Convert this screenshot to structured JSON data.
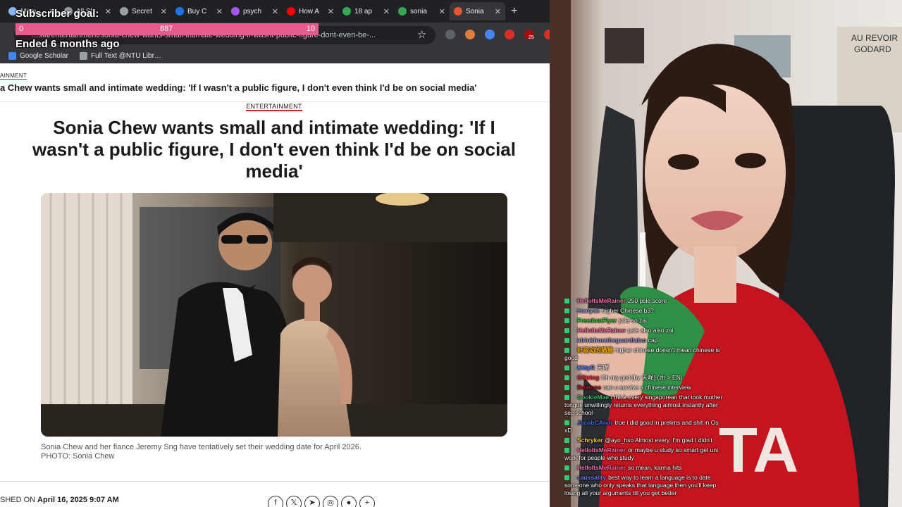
{
  "browser": {
    "tabs": [
      {
        "label": "Mem",
        "color": "#8ab4f8",
        "active": false
      },
      {
        "label": "All Sl",
        "color": "#9aa0a6",
        "active": false
      },
      {
        "label": "Secret",
        "color": "#9aa0a6",
        "active": false
      },
      {
        "label": "Buy C",
        "color": "#1a73e8",
        "active": false
      },
      {
        "label": "psych",
        "color": "#a855f7",
        "active": false
      },
      {
        "label": "How A",
        "color": "#ff0000",
        "active": false
      },
      {
        "label": "18 ap",
        "color": "#34a853",
        "active": false
      },
      {
        "label": "sonia",
        "color": "#34a853",
        "active": false
      },
      {
        "label": "Sonia",
        "color": "#e8542b",
        "active": true
      }
    ],
    "new_tab": "+",
    "url": "…sia/entertainment/sonia-chew-wants-small-intimate-wedding-if-wasnt-public-figure-dont-even-be-...",
    "bookmarks": [
      {
        "label": "Google Scholar",
        "color": "#4285f4"
      },
      {
        "label": "Full Text @NTU Libr…",
        "color": "#9aa0a6"
      }
    ],
    "extension_badge": "25"
  },
  "goal": {
    "title": "Subscriber goal:",
    "min": "0",
    "current": "887",
    "max": "10",
    "ended": "Ended 6 months ago",
    "bar_color": "#e65a8c",
    "progress": 1.0
  },
  "article": {
    "crumb": "AINMENT",
    "sticky_title": "a Chew wants small and intimate wedding: 'If I wasn't a public figure, I don't even think I'd be on social media'",
    "section": "ENTERTAINMENT",
    "headline": "Sonia Chew wants small and intimate wedding: 'If I wasn't a public figure, I don't even think I'd be on social media'",
    "caption": "Sonia Chew and her fiance Jeremy Sng have tentatively set their wedding date for April 2026.",
    "credit": "PHOTO: Sonia Chew",
    "published_label": "SHED ON",
    "published_date": "April 16, 2025 9:07 AM",
    "share": [
      "f",
      "𝕏",
      "➤",
      "◎",
      "●",
      "+"
    ]
  },
  "chat": [
    {
      "user": "HelloItsMeRainer",
      "color": "#ff6fb0",
      "text": "250 psle score"
    },
    {
      "user": "tsanyao",
      "color": "#9a9ad8",
      "text": "higher Chinese b3?"
    },
    {
      "user": "FreedomFlyer",
      "color": "#3fd13f",
      "text": "jolie so zai"
    },
    {
      "user": "HelloItsMeRainer",
      "color": "#ff6fb0",
      "text": "psle also also zai"
    },
    {
      "user": "idrinkfromtheguardialso",
      "color": "#9a9ad8",
      "text": "cap"
    },
    {
      "user": "好寂动的猫猫",
      "color": "#ffb300",
      "text": "higher chinese doesn't mean chinese is good"
    },
    {
      "user": "KittyR",
      "color": "#5b8cff",
      "text": "天呢"
    },
    {
      "user": "GString",
      "color": "#ff3b3b",
      "text": "Oh my god [by 天呢] (zh > EN)"
    },
    {
      "user": "Duxtone",
      "color": "#b22222",
      "text": "can u survive a chinese interview"
    },
    {
      "user": "CookieMae",
      "color": "#39c06b",
      "text": "i think every singaporean that took mother tongue unwillingly returns everything almost instantly after sec school"
    },
    {
      "user": "JacobCAndr",
      "color": "#4169e1",
      "text": "true i did good in prelims and shit in Os xD"
    },
    {
      "user": "Schryker",
      "color": "#ffd700",
      "text": "@ayo_hso Almost every. I'm glad I didn't"
    },
    {
      "user": "HelloItsMeRainer",
      "color": "#ff6fb0",
      "text": "or maybe u study so smart get uni work for people who study"
    },
    {
      "user": "HelloItsMeRainer",
      "color": "#ff6fb0",
      "text": "so mean, karma hits"
    },
    {
      "user": "caussality",
      "color": "#7a7aff",
      "text": "best way to learn a language is to date someone who only speaks that language then you'll keep losing all your arguments till you get better"
    }
  ]
}
